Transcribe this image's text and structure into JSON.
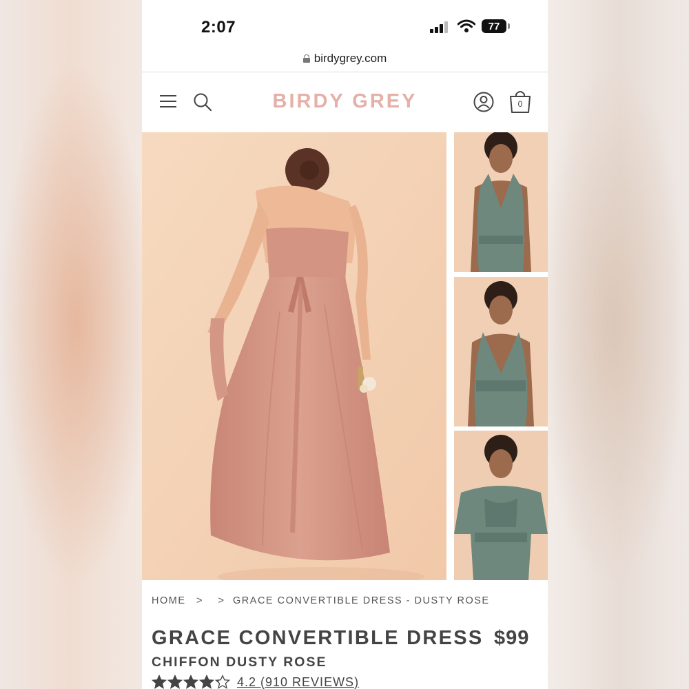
{
  "status_bar": {
    "time": "2:07",
    "battery": "77"
  },
  "browser": {
    "url": "birdygrey.com"
  },
  "header": {
    "brand": "BIRDY GREY",
    "cart_count": "0"
  },
  "breadcrumb": {
    "home": "HOME",
    "sep1": ">",
    "sep2": ">",
    "current": "GRACE CONVERTIBLE DRESS - DUSTY ROSE"
  },
  "product": {
    "title": "GRACE CONVERTIBLE DRESS",
    "price": "$99",
    "subtitle": "CHIFFON DUSTY ROSE",
    "rating_text": "4.2 (910 REVIEWS)",
    "rating_value": 4.2,
    "rating_max": 5
  },
  "colors": {
    "brand": "#e4b0a8",
    "text": "#444444",
    "dress_main": "#d49786",
    "dress_thumbs": "#6e887e"
  },
  "icons": [
    "lock-icon",
    "menu-icon",
    "search-icon",
    "account-icon",
    "shopping-bag-icon",
    "star-icon"
  ]
}
